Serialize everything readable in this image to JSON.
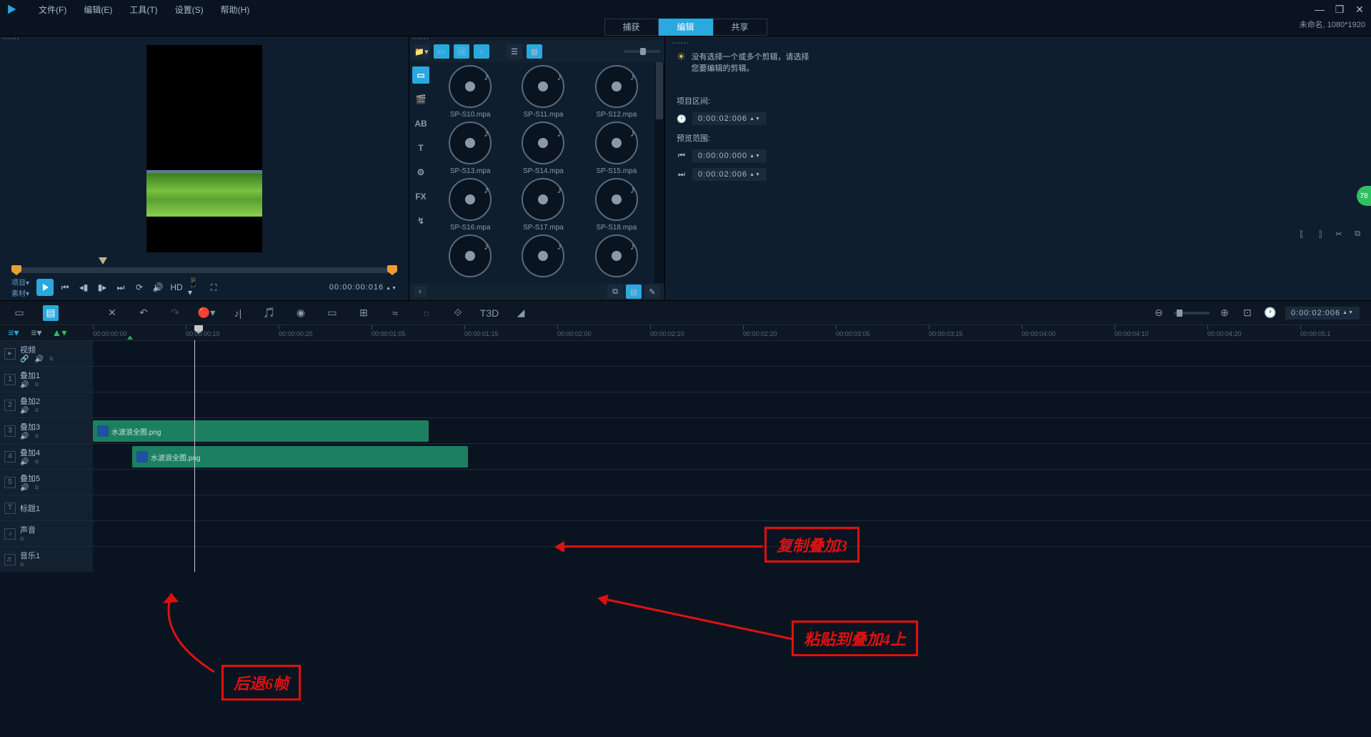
{
  "menu": {
    "file": "文件(F)",
    "edit": "编辑(E)",
    "tools": "工具(T)",
    "settings": "设置(S)",
    "help": "帮助(H)"
  },
  "window_title": "未命名, 1080*1920",
  "mode_tabs": {
    "capture": "捕获",
    "edit": "编辑",
    "share": "共享"
  },
  "transport": {
    "project": "项目▾",
    "clip": "素材▾",
    "hd": "HD",
    "timecode": "00:00:00:016"
  },
  "library": {
    "items": [
      "SP-S10.mpa",
      "SP-S11.mpa",
      "SP-S12.mpa",
      "SP-S13.mpa",
      "SP-S14.mpa",
      "SP-S15.mpa",
      "SP-S16.mpa",
      "SP-S17.mpa",
      "SP-S18.mpa",
      "",
      "",
      ""
    ]
  },
  "options": {
    "hint_l1": "没有选择一个或多个剪辑，请选择",
    "hint_l2": "您要编辑的剪辑。",
    "section_label": "项目区间:",
    "duration": "0:00:02:006",
    "range_label": "预览范围:",
    "range_start": "0:00:00:000",
    "range_end": "0:00:02:006"
  },
  "toolbar": {
    "t3d": "T3D",
    "fx": "FX",
    "ab": "AB",
    "t": "T"
  },
  "ruler": {
    "ticks": [
      "00:00:00:00",
      "00:00:00:10",
      "00:00:00:20",
      "00:00:01:05",
      "00:00:01:15",
      "00:00:02:00",
      "00:00:02:10",
      "00:00:02:20",
      "00:00:03:05",
      "00:00:03:15",
      "00:00:04:00",
      "00:00:04:10",
      "00:00:04:20",
      "00:00:05:1"
    ]
  },
  "tl_right_tc": "0:00:02:006",
  "tracks": [
    {
      "icon": "▸",
      "name": "视频",
      "sub": [
        "🔗",
        "🔊",
        "≡"
      ]
    },
    {
      "icon": "1",
      "name": "叠加1",
      "sub": [
        "🔊",
        "≡"
      ]
    },
    {
      "icon": "2",
      "name": "叠加2",
      "sub": [
        "🔊",
        "≡"
      ]
    },
    {
      "icon": "3",
      "name": "叠加3",
      "sub": [
        "🔊",
        "≡"
      ]
    },
    {
      "icon": "4",
      "name": "叠加4",
      "sub": [
        "🔊",
        "≡"
      ]
    },
    {
      "icon": "5",
      "name": "叠加5",
      "sub": [
        "🔊",
        "≡"
      ]
    },
    {
      "icon": "T",
      "name": "标题1",
      "sub": []
    },
    {
      "icon": "♪",
      "name": "声音",
      "sub": [
        "≡"
      ]
    },
    {
      "icon": "♬",
      "name": "音乐1",
      "sub": [
        "≡"
      ]
    }
  ],
  "clips": {
    "clip3": "水波浪全图.png",
    "clip4": "水波浪全图.png"
  },
  "annotations": {
    "a1": "复制叠加3",
    "a2": "粘贴到叠加4上",
    "a3": "后退6帧"
  },
  "badge": "78"
}
